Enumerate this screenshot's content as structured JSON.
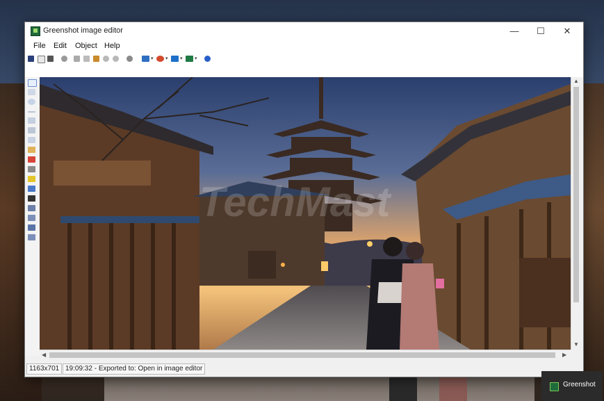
{
  "window": {
    "title": "Greenshot image editor",
    "controls": {
      "minimize": "—",
      "maximize": "☐",
      "close": "✕"
    }
  },
  "menu": {
    "items": [
      {
        "label": "File"
      },
      {
        "label": "Edit"
      },
      {
        "label": "Object"
      },
      {
        "label": "Help"
      }
    ]
  },
  "toolbar": {
    "icons": [
      "save-icon",
      "new-icon",
      "print-icon",
      "stop-icon",
      "cut-icon",
      "copy-icon",
      "paste-icon",
      "undo-icon",
      "redo-icon",
      "settings-icon",
      "image-export-icon",
      "office-export-icon",
      "email-export-icon",
      "excel-export-icon",
      "help-icon"
    ]
  },
  "tools": [
    "cursor-icon",
    "rectangle-icon",
    "ellipse-icon",
    "line-icon",
    "arrow-icon",
    "freehand-icon",
    "text-icon",
    "speechbubble-icon",
    "counter-icon",
    "highlight-icon",
    "obfuscate-icon",
    "crop-icon",
    "resize-icon",
    "rotate-icon",
    "effects-icon",
    "fill-icon"
  ],
  "canvas": {
    "description_alt": "Kyoto street with pagoda at dusk"
  },
  "status": {
    "dimensions": "1163x701",
    "message": "19:09:32 - Exported to: Open in image editor"
  },
  "notification": {
    "label": "Greenshot"
  },
  "colors": {
    "title_bg": "#ffffff",
    "chrome_bg": "#f0f0f0",
    "toast_bg": "#2b2b2b",
    "brand_green": "#1f6b3a"
  }
}
